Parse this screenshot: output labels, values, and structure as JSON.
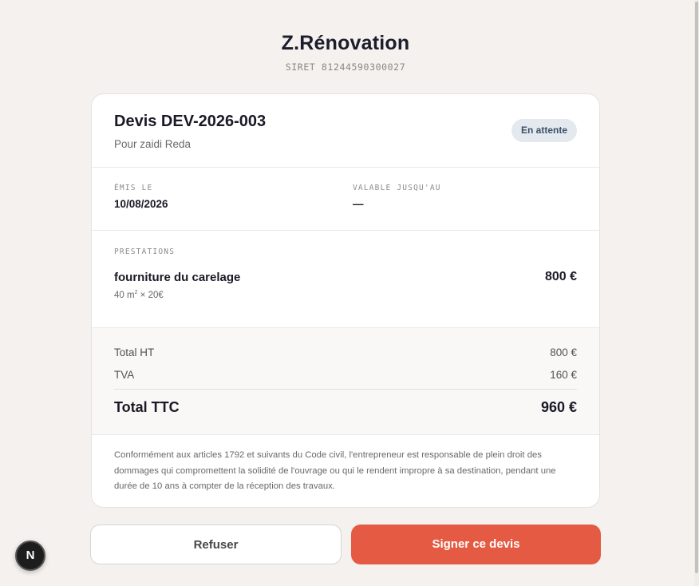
{
  "brand": {
    "name": "Z.Rénovation",
    "siret": "SIRET 81244590300027"
  },
  "quote": {
    "title": "Devis DEV-2026-003",
    "client": "Pour zaidi Reda",
    "status": "En attente"
  },
  "dates": {
    "issued_label": "ÉMIS LE",
    "issued_value": "10/08/2026",
    "valid_label": "VALABLE JUSQU'AU",
    "valid_value": "—"
  },
  "items": {
    "label": "PRESTATIONS",
    "rows": [
      {
        "name": "fourniture du carelage",
        "qty_unit": "40 m",
        "unit_exp": "2",
        "unit_price": " × 20€",
        "total": "800 €"
      }
    ]
  },
  "totals": {
    "ht_label": "Total HT",
    "ht_value": "800 €",
    "tva_label": "TVA",
    "tva_value": "160 €",
    "ttc_label": "Total TTC",
    "ttc_value": "960 €"
  },
  "legal": "Conformément aux articles 1792 et suivants du Code civil, l'entrepreneur est responsable de plein droit des dommages qui compromettent la solidité de l'ouvrage ou qui le rendent impropre à sa destination, pendant une durée de 10 ans à compter de la réception des travaux.",
  "actions": {
    "refuse": "Refuser",
    "sign": "Signer ce devis"
  },
  "avatar": {
    "initial": "N"
  },
  "colors": {
    "accent": "#e55a42",
    "badge_bg": "#e3e9ef",
    "background": "#f4f1ee"
  }
}
